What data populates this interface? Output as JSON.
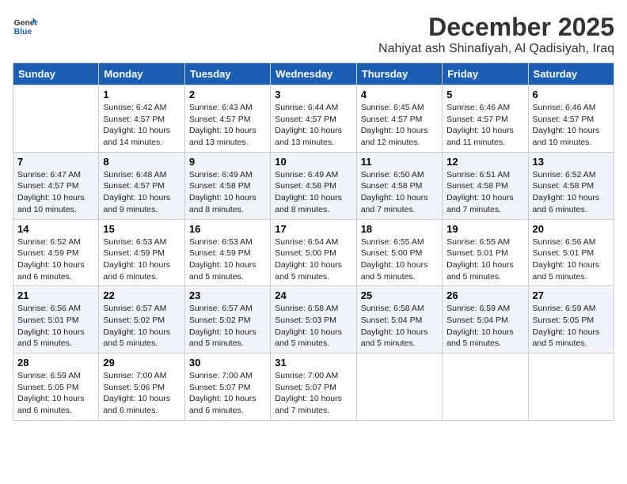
{
  "logo": {
    "line1": "General",
    "line2": "Blue"
  },
  "title": "December 2025",
  "subtitle": "Nahiyat ash Shinafiyah, Al Qadisiyah, Iraq",
  "days_of_week": [
    "Sunday",
    "Monday",
    "Tuesday",
    "Wednesday",
    "Thursday",
    "Friday",
    "Saturday"
  ],
  "weeks": [
    [
      {
        "day": "",
        "sunrise": "",
        "sunset": "",
        "daylight": ""
      },
      {
        "day": "1",
        "sunrise": "Sunrise: 6:42 AM",
        "sunset": "Sunset: 4:57 PM",
        "daylight": "Daylight: 10 hours and 14 minutes."
      },
      {
        "day": "2",
        "sunrise": "Sunrise: 6:43 AM",
        "sunset": "Sunset: 4:57 PM",
        "daylight": "Daylight: 10 hours and 13 minutes."
      },
      {
        "day": "3",
        "sunrise": "Sunrise: 6:44 AM",
        "sunset": "Sunset: 4:57 PM",
        "daylight": "Daylight: 10 hours and 13 minutes."
      },
      {
        "day": "4",
        "sunrise": "Sunrise: 6:45 AM",
        "sunset": "Sunset: 4:57 PM",
        "daylight": "Daylight: 10 hours and 12 minutes."
      },
      {
        "day": "5",
        "sunrise": "Sunrise: 6:46 AM",
        "sunset": "Sunset: 4:57 PM",
        "daylight": "Daylight: 10 hours and 11 minutes."
      },
      {
        "day": "6",
        "sunrise": "Sunrise: 6:46 AM",
        "sunset": "Sunset: 4:57 PM",
        "daylight": "Daylight: 10 hours and 10 minutes."
      }
    ],
    [
      {
        "day": "7",
        "sunrise": "Sunrise: 6:47 AM",
        "sunset": "Sunset: 4:57 PM",
        "daylight": "Daylight: 10 hours and 10 minutes."
      },
      {
        "day": "8",
        "sunrise": "Sunrise: 6:48 AM",
        "sunset": "Sunset: 4:57 PM",
        "daylight": "Daylight: 10 hours and 9 minutes."
      },
      {
        "day": "9",
        "sunrise": "Sunrise: 6:49 AM",
        "sunset": "Sunset: 4:58 PM",
        "daylight": "Daylight: 10 hours and 8 minutes."
      },
      {
        "day": "10",
        "sunrise": "Sunrise: 6:49 AM",
        "sunset": "Sunset: 4:58 PM",
        "daylight": "Daylight: 10 hours and 8 minutes."
      },
      {
        "day": "11",
        "sunrise": "Sunrise: 6:50 AM",
        "sunset": "Sunset: 4:58 PM",
        "daylight": "Daylight: 10 hours and 7 minutes."
      },
      {
        "day": "12",
        "sunrise": "Sunrise: 6:51 AM",
        "sunset": "Sunset: 4:58 PM",
        "daylight": "Daylight: 10 hours and 7 minutes."
      },
      {
        "day": "13",
        "sunrise": "Sunrise: 6:52 AM",
        "sunset": "Sunset: 4:58 PM",
        "daylight": "Daylight: 10 hours and 6 minutes."
      }
    ],
    [
      {
        "day": "14",
        "sunrise": "Sunrise: 6:52 AM",
        "sunset": "Sunset: 4:59 PM",
        "daylight": "Daylight: 10 hours and 6 minutes."
      },
      {
        "day": "15",
        "sunrise": "Sunrise: 6:53 AM",
        "sunset": "Sunset: 4:59 PM",
        "daylight": "Daylight: 10 hours and 6 minutes."
      },
      {
        "day": "16",
        "sunrise": "Sunrise: 6:53 AM",
        "sunset": "Sunset: 4:59 PM",
        "daylight": "Daylight: 10 hours and 5 minutes."
      },
      {
        "day": "17",
        "sunrise": "Sunrise: 6:54 AM",
        "sunset": "Sunset: 5:00 PM",
        "daylight": "Daylight: 10 hours and 5 minutes."
      },
      {
        "day": "18",
        "sunrise": "Sunrise: 6:55 AM",
        "sunset": "Sunset: 5:00 PM",
        "daylight": "Daylight: 10 hours and 5 minutes."
      },
      {
        "day": "19",
        "sunrise": "Sunrise: 6:55 AM",
        "sunset": "Sunset: 5:01 PM",
        "daylight": "Daylight: 10 hours and 5 minutes."
      },
      {
        "day": "20",
        "sunrise": "Sunrise: 6:56 AM",
        "sunset": "Sunset: 5:01 PM",
        "daylight": "Daylight: 10 hours and 5 minutes."
      }
    ],
    [
      {
        "day": "21",
        "sunrise": "Sunrise: 6:56 AM",
        "sunset": "Sunset: 5:01 PM",
        "daylight": "Daylight: 10 hours and 5 minutes."
      },
      {
        "day": "22",
        "sunrise": "Sunrise: 6:57 AM",
        "sunset": "Sunset: 5:02 PM",
        "daylight": "Daylight: 10 hours and 5 minutes."
      },
      {
        "day": "23",
        "sunrise": "Sunrise: 6:57 AM",
        "sunset": "Sunset: 5:02 PM",
        "daylight": "Daylight: 10 hours and 5 minutes."
      },
      {
        "day": "24",
        "sunrise": "Sunrise: 6:58 AM",
        "sunset": "Sunset: 5:03 PM",
        "daylight": "Daylight: 10 hours and 5 minutes."
      },
      {
        "day": "25",
        "sunrise": "Sunrise: 6:58 AM",
        "sunset": "Sunset: 5:04 PM",
        "daylight": "Daylight: 10 hours and 5 minutes."
      },
      {
        "day": "26",
        "sunrise": "Sunrise: 6:59 AM",
        "sunset": "Sunset: 5:04 PM",
        "daylight": "Daylight: 10 hours and 5 minutes."
      },
      {
        "day": "27",
        "sunrise": "Sunrise: 6:59 AM",
        "sunset": "Sunset: 5:05 PM",
        "daylight": "Daylight: 10 hours and 5 minutes."
      }
    ],
    [
      {
        "day": "28",
        "sunrise": "Sunrise: 6:59 AM",
        "sunset": "Sunset: 5:05 PM",
        "daylight": "Daylight: 10 hours and 6 minutes."
      },
      {
        "day": "29",
        "sunrise": "Sunrise: 7:00 AM",
        "sunset": "Sunset: 5:06 PM",
        "daylight": "Daylight: 10 hours and 6 minutes."
      },
      {
        "day": "30",
        "sunrise": "Sunrise: 7:00 AM",
        "sunset": "Sunset: 5:07 PM",
        "daylight": "Daylight: 10 hours and 6 minutes."
      },
      {
        "day": "31",
        "sunrise": "Sunrise: 7:00 AM",
        "sunset": "Sunset: 5:07 PM",
        "daylight": "Daylight: 10 hours and 7 minutes."
      },
      {
        "day": "",
        "sunrise": "",
        "sunset": "",
        "daylight": ""
      },
      {
        "day": "",
        "sunrise": "",
        "sunset": "",
        "daylight": ""
      },
      {
        "day": "",
        "sunrise": "",
        "sunset": "",
        "daylight": ""
      }
    ]
  ]
}
